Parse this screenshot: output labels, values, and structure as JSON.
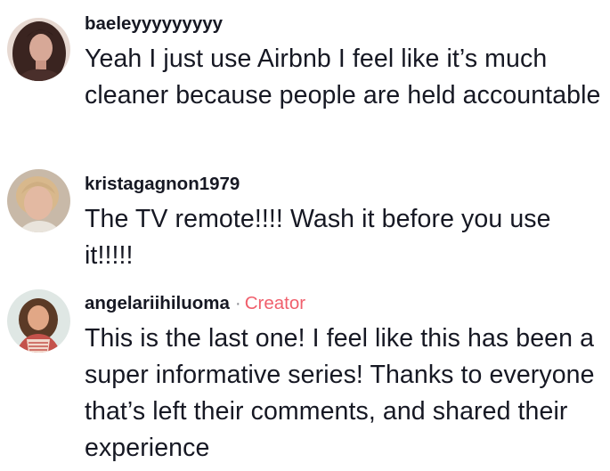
{
  "comments": [
    {
      "username": "baeleyyyyyyyyy",
      "text": "Yeah I just use Airbnb I feel like it’s much cleaner because people are held accountable",
      "avatar": "user-photo-dark-hair"
    },
    {
      "username": "kristagagnon1979",
      "text": "The TV remote!!!! Wash it before you use it!!!!!",
      "avatar": "user-photo-blonde"
    },
    {
      "username": "angelariihiluoma",
      "separator": "·",
      "badge": "Creator",
      "text": "This is the last one! I feel like this has been a super informative series! Thanks to everyone that’s left their comments, and shared their experience",
      "avatar": "user-photo-brunette"
    }
  ],
  "colors": {
    "text": "#161823",
    "creator_badge": "#f05f6c",
    "separator": "#8a8b91"
  }
}
